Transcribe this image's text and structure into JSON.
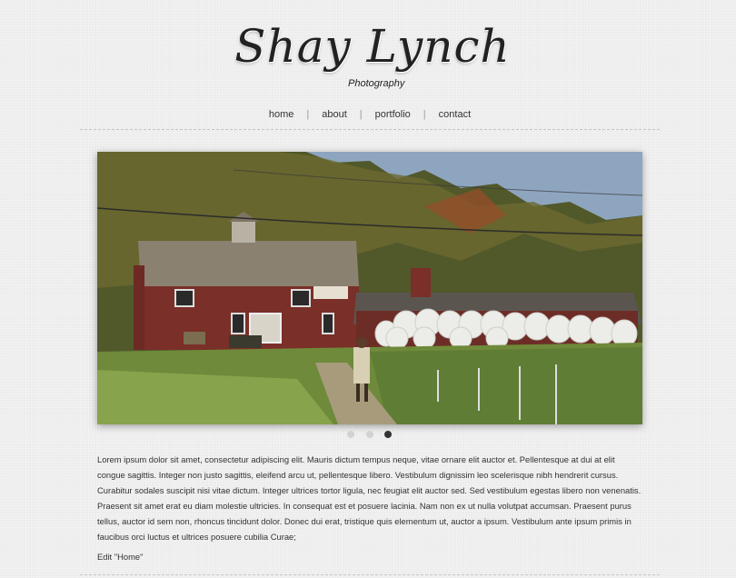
{
  "logo": {
    "name": "Shay Lynch",
    "tagline": "Photography"
  },
  "nav": {
    "items": [
      {
        "label": "home"
      },
      {
        "label": "about"
      },
      {
        "label": "portfolio"
      },
      {
        "label": "contact"
      }
    ],
    "separator": "|"
  },
  "slider": {
    "image_desc": "red-barn-hay-bales-photo",
    "slides": 3,
    "active_index": 2
  },
  "content": {
    "paragraph": "Lorem ipsum dolor sit amet, consectetur adipiscing elit. Mauris dictum tempus neque, vitae ornare elit auctor et. Pellentesque at dui at elit congue sagittis. Integer non justo sagittis, eleifend arcu ut, pellentesque libero. Vestibulum dignissim leo scelerisque nibh hendrerit cursus. Curabitur sodales suscipit nisi vitae dictum. Integer ultrices tortor ligula, nec feugiat elit auctor sed. Sed vestibulum egestas libero non venenatis. Praesent sit amet erat eu diam molestie ultricies. In consequat est et posuere lacinia. Nam non ex ut nulla volutpat accumsan. Praesent purus tellus, auctor id sem non, rhoncus tincidunt dolor. Donec dui erat, tristique quis elementum ut, auctor a ipsum. Vestibulum ante ipsum primis in faucibus orci luctus et ultrices posuere cubilia Curae;",
    "edit_link": "Edit \"Home\""
  },
  "colors": {
    "background": "#ececec",
    "text": "#333333",
    "dot_active": "#333333",
    "dot_inactive": "#d2d2d2"
  }
}
